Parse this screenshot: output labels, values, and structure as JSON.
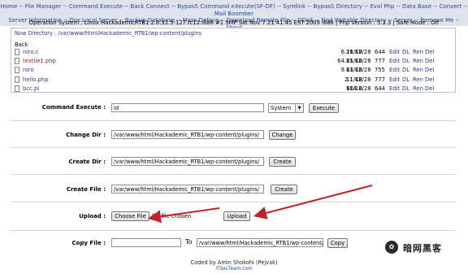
{
  "nav": {
    "line1": [
      "Home",
      "File Manager",
      "Command Execute",
      "Back Connect",
      "BypasS Command eXecute(SF-DF)",
      "Symlink",
      "BypasS Directory",
      "Eval Php",
      "Data Base",
      "Convert",
      "Mail Boomber"
    ],
    "line2": [
      "Server Information",
      "Dos Local Server",
      "Backup Database",
      "Mass Deface",
      "Download Remote File",
      "DDoS",
      "Find Writable Directory",
      "Server",
      "Remove Me",
      "About"
    ],
    "separator": " -- "
  },
  "sysinfo": "Operation System : Linux HackademicRTB1 2.6.31.5-127.fc12.i686 #1 SMP Sat Nov 7 21:41:45 EST 2009 i686 | Php Version : 5.3.3 | Safe Mode : Off",
  "listing": {
    "current_dir": "Now Directory : /var/www/html/Hackademic_RTB1/wp-content/plugins",
    "back_label": "Back",
    "files": [
      {
        "name": "roro.c",
        "size": "6.28 KB",
        "date": "11/12/28",
        "perm": "644",
        "style": "blue"
      },
      {
        "name": "textile1.php",
        "size": "64.85 KB",
        "date": "11/12/28",
        "perm": "777",
        "style": "red"
      },
      {
        "name": "roro",
        "size": "9.63 KB",
        "date": "11/12/28",
        "perm": "755",
        "style": "blue"
      },
      {
        "name": "hello.php",
        "size": "2.1 KB",
        "date": "11/12/28",
        "perm": "777",
        "style": "blue"
      },
      {
        "name": "bcc.pl",
        "size": "604 B",
        "date": "11/12/28",
        "perm": "644",
        "style": "blue"
      }
    ],
    "actions": [
      "Edit",
      "DL",
      "Ren",
      "Del"
    ]
  },
  "command_execute": {
    "label": "Command Execute :",
    "value": "id",
    "select_value": "System",
    "button": "Execute"
  },
  "change_dir": {
    "label": "Change Dir :",
    "value": "/var/www/html/Hackademic_RTB1/wp-content/plugins/",
    "button": "Change"
  },
  "create_dir": {
    "label": "Create Dir :",
    "value": "/var/www/html/Hackademic_RTB1/wp-content/plugins/",
    "button": "Create"
  },
  "create_file": {
    "label": "Create File :",
    "value": "/var/www/html/Hackademic_RTB1/wp-content/plugins/",
    "button": "Create"
  },
  "upload": {
    "label": "Upload :",
    "choose_button": "Choose File",
    "no_file": "No file chosen",
    "button": "Upload"
  },
  "copy_file": {
    "label": "Copy File :",
    "value": "",
    "to_label": "To",
    "to_value": "/var/www/html/Hackademic_RTB1/wp-content/p",
    "button": "Copy"
  },
  "footer": {
    "credit": "Coded by Amin Shokohi (Pejvak)",
    "link": "ITSecTeam.com"
  },
  "watermark": {
    "text": "暗网黑客"
  },
  "colors": {
    "nav_bg": "#e0e4ea",
    "link": "#2344a8",
    "arrow": "#c0242b"
  }
}
